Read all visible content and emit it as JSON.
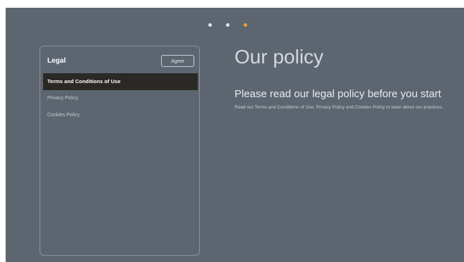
{
  "pagination": {
    "total": 3,
    "active_index": 2,
    "active_color": "#f0a21f",
    "inactive_color": "#e2e5e8"
  },
  "sidebar": {
    "title": "Legal",
    "agree_label": "Agree",
    "items": [
      {
        "label": "Terms and Conditions of Use",
        "selected": true
      },
      {
        "label": "Privacy Policy",
        "selected": false
      },
      {
        "label": "Cookies Policy",
        "selected": false
      }
    ]
  },
  "main": {
    "heading": "Our policy",
    "subheading": "Please read our legal policy before you start",
    "body": "Read our Terms and Conditions of Use, Privacy Policy and Cookies Policy to learn about our practices."
  },
  "colors": {
    "background": "#5d6670",
    "selected_item_bg": "#2c2826"
  }
}
